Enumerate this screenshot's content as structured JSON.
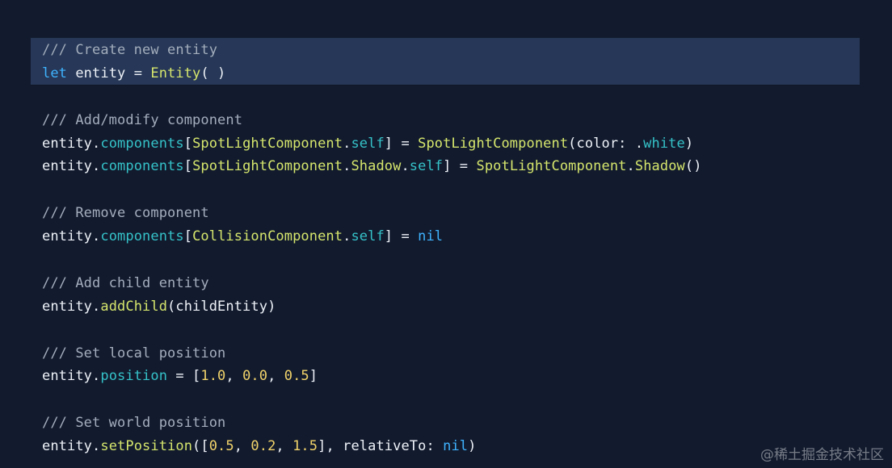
{
  "code_lines": [
    [
      {
        "t": "comment",
        "v": "/// Create new entity"
      }
    ],
    [
      {
        "t": "keyword",
        "v": "let"
      },
      {
        "t": "plain",
        "v": " entity = "
      },
      {
        "t": "type",
        "v": "Entity"
      },
      {
        "t": "plain",
        "v": "( )"
      }
    ],
    [],
    [
      {
        "t": "comment",
        "v": "/// Add/modify component"
      }
    ],
    [
      {
        "t": "plain",
        "v": "entity."
      },
      {
        "t": "prop",
        "v": "components"
      },
      {
        "t": "plain",
        "v": "["
      },
      {
        "t": "type",
        "v": "SpotLightComponent"
      },
      {
        "t": "plain",
        "v": "."
      },
      {
        "t": "prop",
        "v": "self"
      },
      {
        "t": "plain",
        "v": "] = "
      },
      {
        "t": "type",
        "v": "SpotLightComponent"
      },
      {
        "t": "plain",
        "v": "(color: ."
      },
      {
        "t": "prop",
        "v": "white"
      },
      {
        "t": "plain",
        "v": ")"
      }
    ],
    [
      {
        "t": "plain",
        "v": "entity."
      },
      {
        "t": "prop",
        "v": "components"
      },
      {
        "t": "plain",
        "v": "["
      },
      {
        "t": "type",
        "v": "SpotLightComponent"
      },
      {
        "t": "plain",
        "v": "."
      },
      {
        "t": "type",
        "v": "Shadow"
      },
      {
        "t": "plain",
        "v": "."
      },
      {
        "t": "prop",
        "v": "self"
      },
      {
        "t": "plain",
        "v": "] = "
      },
      {
        "t": "type",
        "v": "SpotLightComponent"
      },
      {
        "t": "plain",
        "v": "."
      },
      {
        "t": "type",
        "v": "Shadow"
      },
      {
        "t": "plain",
        "v": "()"
      }
    ],
    [],
    [
      {
        "t": "comment",
        "v": "/// Remove component"
      }
    ],
    [
      {
        "t": "plain",
        "v": "entity."
      },
      {
        "t": "prop",
        "v": "components"
      },
      {
        "t": "plain",
        "v": "["
      },
      {
        "t": "type",
        "v": "CollisionComponent"
      },
      {
        "t": "plain",
        "v": "."
      },
      {
        "t": "prop",
        "v": "self"
      },
      {
        "t": "plain",
        "v": "] = "
      },
      {
        "t": "keyword",
        "v": "nil"
      }
    ],
    [],
    [
      {
        "t": "comment",
        "v": "/// Add child entity"
      }
    ],
    [
      {
        "t": "plain",
        "v": "entity."
      },
      {
        "t": "type",
        "v": "addChild"
      },
      {
        "t": "plain",
        "v": "(childEntity)"
      }
    ],
    [],
    [
      {
        "t": "comment",
        "v": "/// Set local position"
      }
    ],
    [
      {
        "t": "plain",
        "v": "entity."
      },
      {
        "t": "prop",
        "v": "position"
      },
      {
        "t": "plain",
        "v": " = ["
      },
      {
        "t": "num",
        "v": "1.0"
      },
      {
        "t": "plain",
        "v": ", "
      },
      {
        "t": "num",
        "v": "0.0"
      },
      {
        "t": "plain",
        "v": ", "
      },
      {
        "t": "num",
        "v": "0.5"
      },
      {
        "t": "plain",
        "v": "]"
      }
    ],
    [],
    [
      {
        "t": "comment",
        "v": "/// Set world position"
      }
    ],
    [
      {
        "t": "plain",
        "v": "entity."
      },
      {
        "t": "type",
        "v": "setPosition"
      },
      {
        "t": "plain",
        "v": "(["
      },
      {
        "t": "num",
        "v": "0.5"
      },
      {
        "t": "plain",
        "v": ", "
      },
      {
        "t": "num",
        "v": "0.2"
      },
      {
        "t": "plain",
        "v": ", "
      },
      {
        "t": "num",
        "v": "1.5"
      },
      {
        "t": "plain",
        "v": "], relativeTo: "
      },
      {
        "t": "keyword",
        "v": "nil"
      },
      {
        "t": "plain",
        "v": ")"
      }
    ]
  ],
  "highlighted_lines": [
    0,
    1
  ],
  "watermark": "@稀土掘金技术社区",
  "colors": {
    "background": "#121b2e",
    "highlight": "#263757",
    "comment": "#a3adbc",
    "keyword": "#3fb3ff",
    "type": "#d6e66c",
    "property": "#35c2c8",
    "number": "#f2d36a",
    "plain": "#eef2f8"
  }
}
